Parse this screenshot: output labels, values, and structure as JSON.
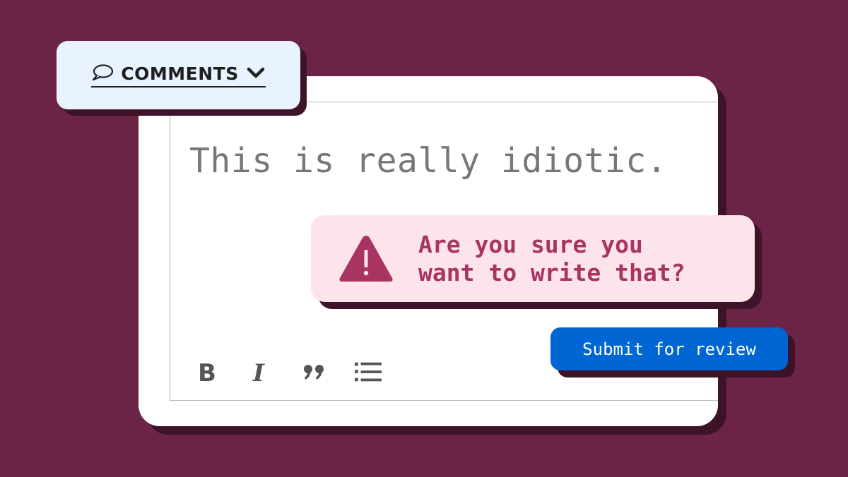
{
  "comments_tab": {
    "label": "COMMENTS",
    "icon": "speech-bubble-icon",
    "chevron": "chevron-down-icon"
  },
  "editor": {
    "text": "This is really idiotic."
  },
  "warning": {
    "icon": "warning-triangle-icon",
    "line1": "Are you sure you",
    "line2": "want to write that?"
  },
  "submit": {
    "label": "Submit for review"
  },
  "toolbar": {
    "items": [
      "bold-icon",
      "italic-icon",
      "quote-icon",
      "bullet-list-icon"
    ]
  },
  "colors": {
    "background": "#6c2446",
    "shadow": "#3d1328",
    "warning_bg": "#fde3ea",
    "warning_accent": "#a83462",
    "button": "#0066d4",
    "tab_bg": "#e9f3ff"
  }
}
